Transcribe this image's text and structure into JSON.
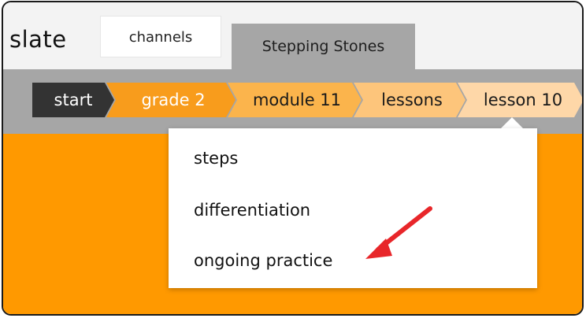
{
  "app": {
    "title": "slate"
  },
  "tabs": [
    {
      "label": "channels",
      "active": false
    },
    {
      "label": "Stepping Stones",
      "active": true
    }
  ],
  "breadcrumb": [
    {
      "label": "start"
    },
    {
      "label": "grade 2"
    },
    {
      "label": "module 11"
    },
    {
      "label": "lessons"
    },
    {
      "label": "lesson 10"
    }
  ],
  "dropdown": {
    "items": [
      {
        "label": "steps"
      },
      {
        "label": "differentiation"
      },
      {
        "label": "ongoing practice"
      }
    ]
  },
  "annotation": {
    "icon": "red-arrow-icon",
    "color": "#e8262a"
  },
  "colors": {
    "accent": "#ff9900",
    "crumb_start": "#333333",
    "bar_gray": "#a6a6a6"
  }
}
